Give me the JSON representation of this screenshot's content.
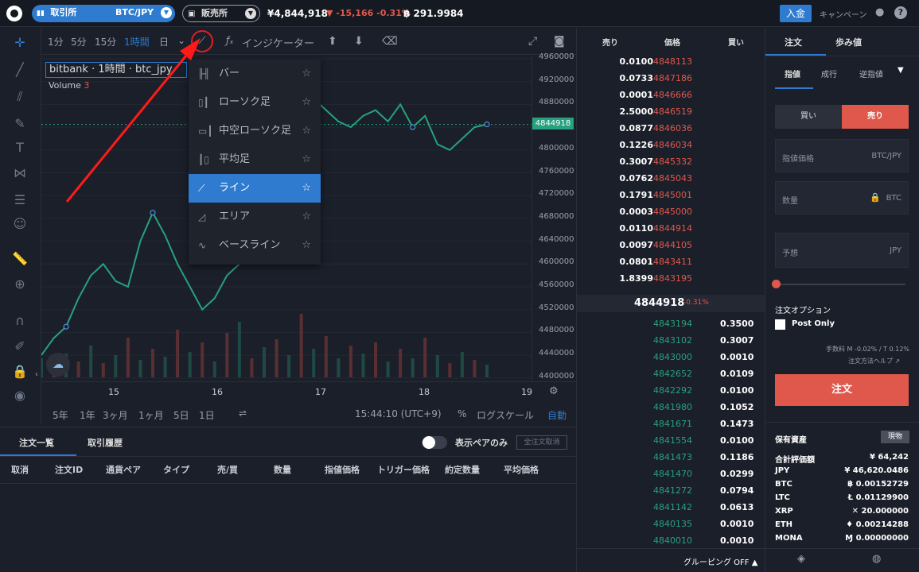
{
  "topbar": {
    "exchange_label": "取引所",
    "pair": "BTC/JPY",
    "market_label": "販売所",
    "price": "¥4,844,918",
    "change": "-15,166 -0.31%",
    "btc_balance": "฿ 291.9984",
    "deposit_label": "入金",
    "campaign_label": "キャンペーン"
  },
  "chart_toolbar": {
    "intervals": [
      "1分",
      "5分",
      "15分",
      "1時間",
      "日"
    ],
    "active_interval": "1時間",
    "indicator_label": "インジケーター"
  },
  "legend": {
    "text": "bitbank · 1時間 · btc_jpy",
    "volume_label": "Volume",
    "volume_value": "3"
  },
  "chart_type_menu": {
    "items": [
      {
        "label": "バー",
        "icon": "bar-chart-icon"
      },
      {
        "label": "ローソク足",
        "icon": "candle-icon"
      },
      {
        "label": "中空ローソク足",
        "icon": "hollow-candle-icon"
      },
      {
        "label": "平均足",
        "icon": "heikin-ashi-icon"
      },
      {
        "label": "ライン",
        "icon": "line-chart-icon"
      },
      {
        "label": "エリア",
        "icon": "area-chart-icon"
      },
      {
        "label": "ベースライン",
        "icon": "baseline-icon"
      }
    ],
    "active": "ライン"
  },
  "chart_data": {
    "type": "line",
    "y_ticks": [
      "4960000",
      "4920000",
      "4880000",
      "4840000",
      "4800000",
      "4760000",
      "4720000",
      "4680000",
      "4640000",
      "4600000",
      "4560000",
      "4520000",
      "4480000",
      "4440000",
      "4400000"
    ],
    "ylim": [
      4400000,
      4960000
    ],
    "x_ticks": [
      "15",
      "16",
      "17",
      "18",
      "19"
    ],
    "last_price": "4844918",
    "series": [
      {
        "values": [
          4440000,
          4470000,
          4490000,
          4540000,
          4580000,
          4600000,
          4570000,
          4560000,
          4640000,
          4690000,
          4650000,
          4600000,
          4560000,
          4520000,
          4540000,
          4580000,
          4600000,
          4640000,
          4700000,
          4760000,
          4800000,
          4860000,
          4890000,
          4870000,
          4850000,
          4840000,
          4860000,
          4870000,
          4850000,
          4880000,
          4840000,
          4860000,
          4810000,
          4800000,
          4820000,
          4840000,
          4845000
        ]
      }
    ],
    "volume": [
      12,
      8,
      15,
      10,
      20,
      9,
      14,
      25,
      11,
      18,
      13,
      30,
      16,
      22,
      10,
      28,
      35,
      12,
      19,
      24,
      14,
      40,
      18,
      26,
      12,
      20,
      15,
      22,
      10,
      18,
      12,
      25,
      14,
      9,
      16,
      11,
      8
    ]
  },
  "range_bar": {
    "ranges": [
      "5年",
      "1年",
      "3ヶ月",
      "1ヶ月",
      "5日",
      "1日"
    ],
    "time": "15:44:10 (UTC+9)",
    "percent": "%",
    "log": "ログスケール",
    "auto": "自動"
  },
  "bottom_panel": {
    "tabs": [
      "注文一覧",
      "取引履歴"
    ],
    "show_pair_only": "表示ペアのみ",
    "cancel_all": "全注文取消",
    "columns": [
      "取消",
      "注文ID",
      "通貨ペア",
      "タイプ",
      "売/買",
      "数量",
      "指値価格",
      "トリガー価格",
      "約定数量",
      "平均価格"
    ]
  },
  "orderbook": {
    "headers": [
      "売り",
      "価格",
      "買い"
    ],
    "asks": [
      [
        "0.0100",
        "4848113"
      ],
      [
        "0.0733",
        "4847186"
      ],
      [
        "0.0001",
        "4846666"
      ],
      [
        "2.5000",
        "4846519"
      ],
      [
        "0.0877",
        "4846036"
      ],
      [
        "0.1226",
        "4846034"
      ],
      [
        "0.3007",
        "4845332"
      ],
      [
        "0.0762",
        "4845043"
      ],
      [
        "0.1791",
        "4845001"
      ],
      [
        "0.0003",
        "4845000"
      ],
      [
        "0.0110",
        "4844914"
      ],
      [
        "0.0097",
        "4844105"
      ],
      [
        "0.0801",
        "4843411"
      ],
      [
        "1.8399",
        "4843195"
      ]
    ],
    "mid_price": "4844918",
    "mid_change": "-0.31%",
    "bids": [
      [
        "4843194",
        "0.3500"
      ],
      [
        "4843102",
        "0.3007"
      ],
      [
        "4843000",
        "0.0010"
      ],
      [
        "4842652",
        "0.0109"
      ],
      [
        "4842292",
        "0.0100"
      ],
      [
        "4841980",
        "0.1052"
      ],
      [
        "4841671",
        "0.1473"
      ],
      [
        "4841554",
        "0.0100"
      ],
      [
        "4841473",
        "0.1186"
      ],
      [
        "4841470",
        "0.0299"
      ],
      [
        "4841272",
        "0.0794"
      ],
      [
        "4841142",
        "0.0613"
      ],
      [
        "4840135",
        "0.0010"
      ],
      [
        "4840010",
        "0.0010"
      ]
    ],
    "grouping": "グルーピング OFF"
  },
  "order_panel": {
    "tabs": [
      "注文",
      "歩み値"
    ],
    "subtabs": [
      "指値",
      "成行",
      "逆指値"
    ],
    "buy": "買い",
    "sell": "売り",
    "price_field": "指値価格",
    "price_unit": "BTC/JPY",
    "qty_field": "数量",
    "qty_unit": "BTC",
    "estimate_field": "予想",
    "estimate_unit": "JPY",
    "options_label": "注文オプション",
    "post_only": "Post Only",
    "fee": "手数料 M -0.02% / T 0.12%",
    "help": "注文方法ヘルプ",
    "submit": "注文",
    "assets_label": "保有資産",
    "spot_label": "現物",
    "assets": [
      [
        "合計評価額",
        "¥ 64,242"
      ],
      [
        "JPY",
        "¥ 46,620.0486"
      ],
      [
        "BTC",
        "฿ 0.00152729"
      ],
      [
        "LTC",
        "Ł 0.01129900"
      ],
      [
        "XRP",
        "✕ 20.000000"
      ],
      [
        "ETH",
        "♦ 0.00214288"
      ],
      [
        "MONA",
        "Ɱ 0.00000000"
      ]
    ]
  }
}
